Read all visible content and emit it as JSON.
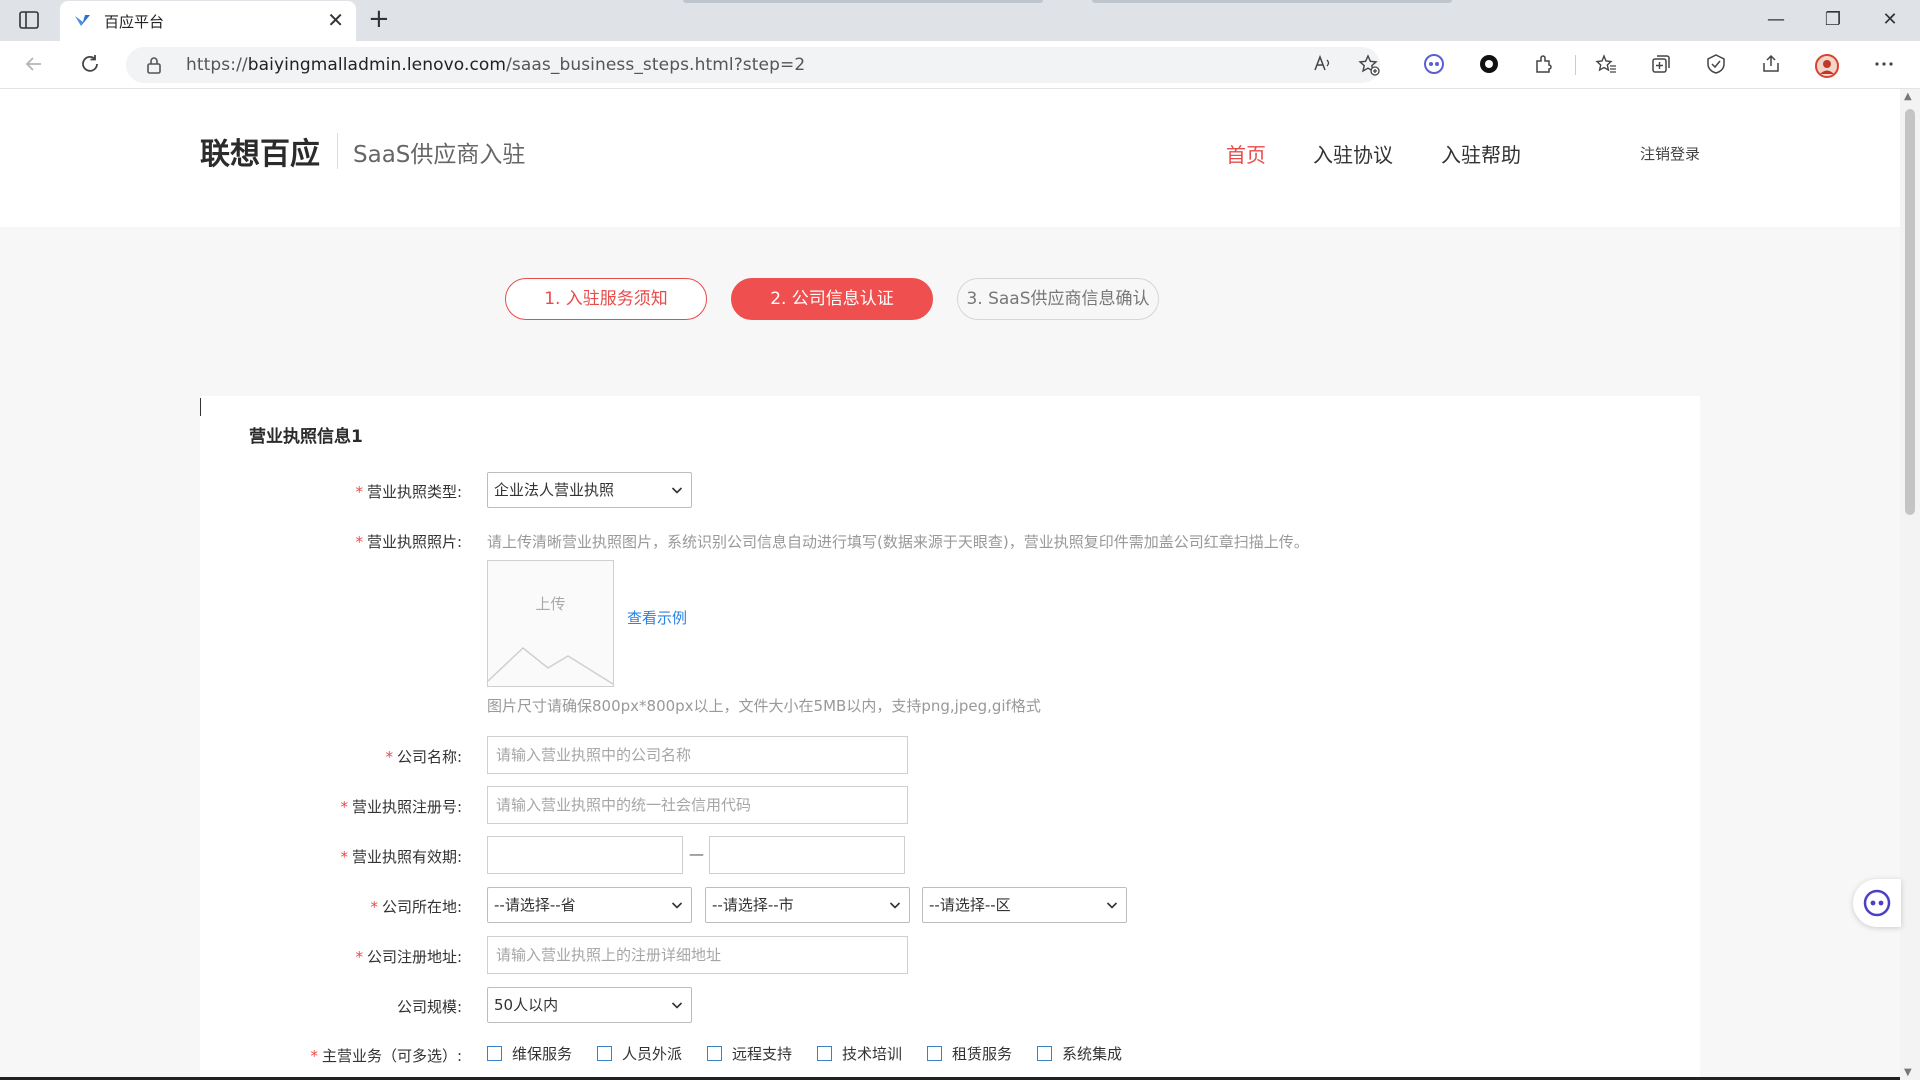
{
  "browser": {
    "tab_title": "百应平台",
    "tab_close": "✕",
    "new_tab": "+",
    "url_prefix": "https://",
    "url_host": "baiyingmalladmin.lenovo.com",
    "url_path": "/saas_business_steps.html?step=2",
    "window_controls": {
      "minimize": "—",
      "restore": "❐",
      "close": "✕"
    },
    "toolbar_icons": [
      "back-icon",
      "refresh-icon",
      "lock-icon",
      "read-aloud-icon",
      "add-favorite-icon",
      "copilot-icon",
      "record-icon",
      "extensions-icon",
      "favorites-icon",
      "collections-icon",
      "browser-essentials-icon",
      "share-icon",
      "profile-avatar",
      "more-icon"
    ]
  },
  "header": {
    "logo": "联想百应",
    "subtitle": "SaaS供应商入驻",
    "nav": [
      "首页",
      "入驻协议",
      "入驻帮助"
    ],
    "logout": "注销登录"
  },
  "steps": [
    "1. 入驻服务须知",
    "2. 公司信息认证",
    "3. SaaS供应商信息确认"
  ],
  "form": {
    "section_title": "营业执照信息1",
    "required_mark": "*",
    "license_type": {
      "label": "营业执照类型:",
      "value": "企业法人营业执照"
    },
    "license_photo": {
      "label": "营业执照照片:",
      "hint": "请上传清晰营业执照图片，系统识别公司信息自动进行填写(数据来源于天眼查)，营业执照复印件需加盖公司红章扫描上传。",
      "upload_label": "上传",
      "example_link": "查看示例",
      "size_hint": "图片尺寸请确保800px*800px以上，文件大小在5MB以内，支持png,jpeg,gif格式"
    },
    "company_name": {
      "label": "公司名称:",
      "placeholder": "请输入营业执照中的公司名称"
    },
    "registration_no": {
      "label": "营业执照注册号:",
      "placeholder": "请输入营业执照中的统一社会信用代码"
    },
    "validity": {
      "label": "营业执照有效期:",
      "separator": "—"
    },
    "location": {
      "label": "公司所在地:",
      "province": "--请选择--省",
      "city": "--请选择--市",
      "district": "--请选择--区"
    },
    "address": {
      "label": "公司注册地址:",
      "placeholder": "请输入营业执照上的注册详细地址"
    },
    "scale": {
      "label": "公司规模:",
      "value": "50人以内"
    },
    "business": {
      "label": "主营业务（可多选）:",
      "options": [
        "维保服务",
        "人员外派",
        "远程支持",
        "技术培训",
        "租赁服务",
        "系统集成"
      ]
    }
  },
  "colors": {
    "accent": "#ef4f4f",
    "link": "#2a82e4",
    "checkbox": "#3b82c4"
  }
}
